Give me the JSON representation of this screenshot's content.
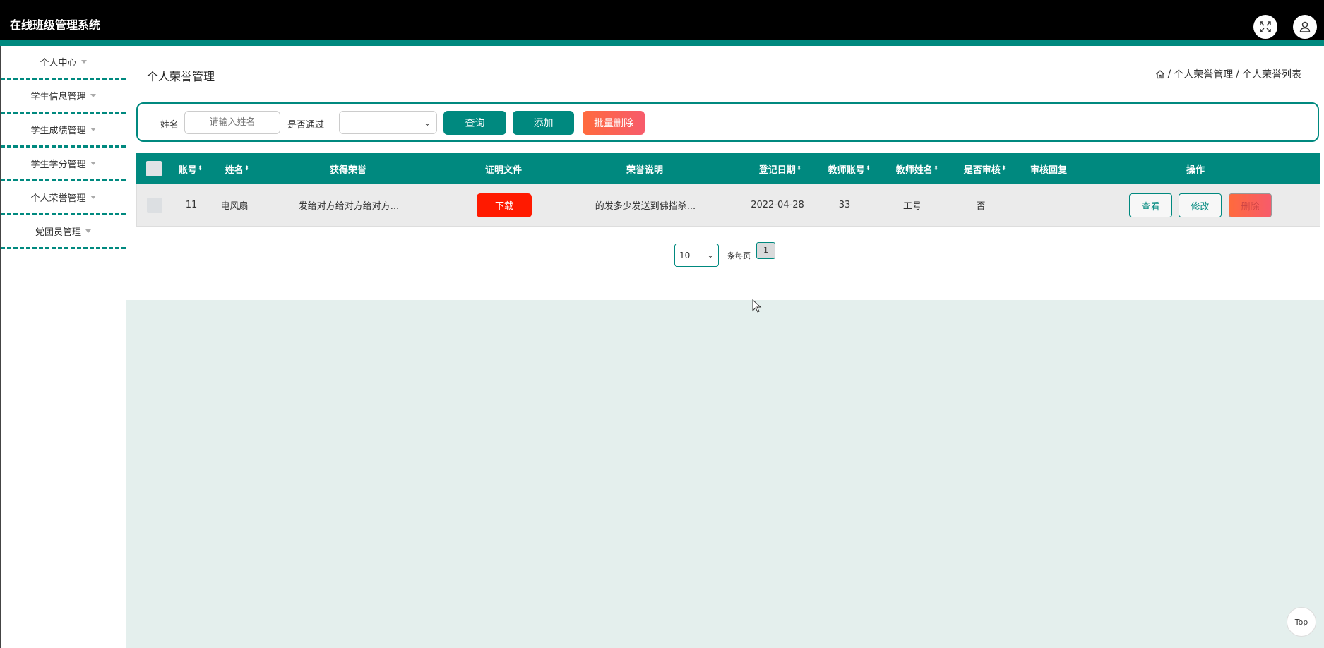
{
  "app": {
    "title": "在线班级管理系统"
  },
  "header": {
    "fullscreen_icon": "expand-icon",
    "user_icon": "user-icon"
  },
  "sidebar": {
    "items": [
      {
        "label": "个人中心"
      },
      {
        "label": "学生信息管理"
      },
      {
        "label": "学生成绩管理"
      },
      {
        "label": "学生学分管理"
      },
      {
        "label": "个人荣誉管理"
      },
      {
        "label": "党团员管理"
      }
    ]
  },
  "page": {
    "title": "个人荣誉管理",
    "breadcrumb": [
      "个人荣誉管理",
      "个人荣誉列表"
    ]
  },
  "search": {
    "name_label": "姓名",
    "name_placeholder": "请输入姓名",
    "pass_label": "是否通过",
    "query_label": "查询",
    "add_label": "添加",
    "batch_delete_label": "批量删除"
  },
  "table": {
    "columns": [
      "账号",
      "姓名",
      "获得荣誉",
      "证明文件",
      "荣誉说明",
      "登记日期",
      "教师账号",
      "教师姓名",
      "是否审核",
      "审核回复",
      "操作"
    ],
    "rows": [
      {
        "account": "11",
        "name": "电风扇",
        "honor": "发给对方给对方给对方...",
        "download_label": "下载",
        "desc": "的发多少发送到佛挡杀...",
        "date": "2022-04-28",
        "teacher_account": "33",
        "teacher_name": "工号",
        "reviewed": "否",
        "reply": ""
      }
    ],
    "actions": {
      "view": "查看",
      "edit": "修改",
      "delete": "删除"
    }
  },
  "pager": {
    "page_size": "10",
    "per_page_text": "条每页",
    "current_page": "1"
  },
  "top_button": {
    "label": "Top"
  },
  "colors": {
    "accent": "#00897f",
    "danger": "#ff1a00",
    "header": "#000000",
    "lower_bg": "#e4efed"
  }
}
